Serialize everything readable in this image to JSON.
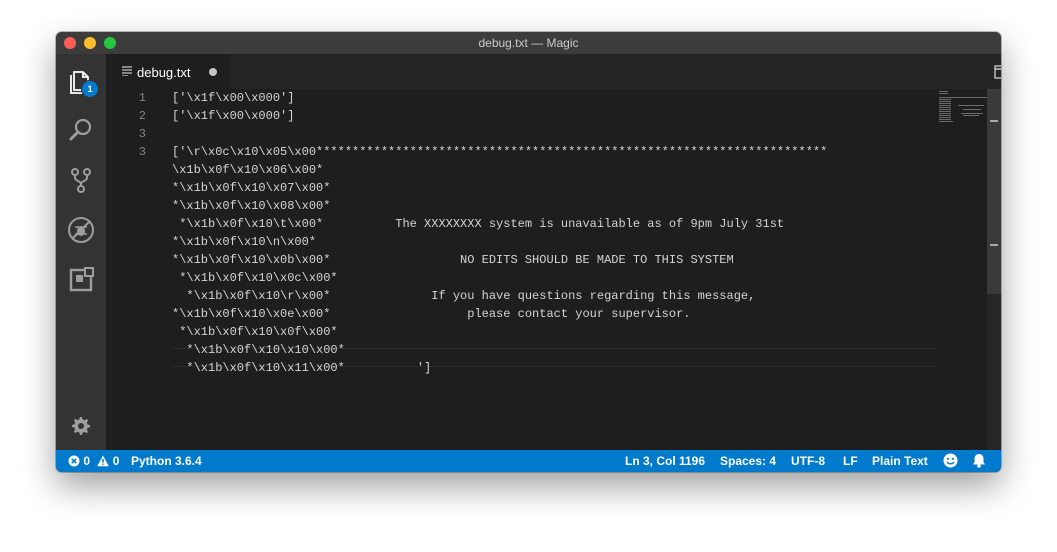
{
  "window": {
    "title": "debug.txt — Magic"
  },
  "activity_bar": {
    "items": [
      {
        "icon": "files-icon",
        "badge": "1"
      },
      {
        "icon": "search-icon"
      },
      {
        "icon": "source-control-icon"
      },
      {
        "icon": "debug-icon"
      },
      {
        "icon": "extensions-icon"
      }
    ],
    "settings_icon": "gear-icon"
  },
  "tab": {
    "label": "debug.txt"
  },
  "editor": {
    "lines": [
      {
        "num": "1",
        "text": "['\\x1f\\x00\\x000']"
      },
      {
        "num": "2",
        "text": "['\\x1f\\x00\\x000']"
      },
      {
        "num": "3",
        "text": ""
      },
      {
        "num": "3",
        "text": "['\\r\\x0c\\x10\\x05\\x00***********************************************************************"
      },
      {
        "num": "",
        "text": "\\x1b\\x0f\\x10\\x06\\x00*"
      },
      {
        "num": "",
        "text": "*\\x1b\\x0f\\x10\\x07\\x00*"
      },
      {
        "num": "",
        "text": "*\\x1b\\x0f\\x10\\x08\\x00*"
      },
      {
        "num": "",
        "text": " *\\x1b\\x0f\\x10\\t\\x00*          The XXXXXXXX system is unavailable as of 9pm July 31st"
      },
      {
        "num": "",
        "text": "*\\x1b\\x0f\\x10\\n\\x00*"
      },
      {
        "num": "",
        "text": "*\\x1b\\x0f\\x10\\x0b\\x00*                  NO EDITS SHOULD BE MADE TO THIS SYSTEM"
      },
      {
        "num": "",
        "text": " *\\x1b\\x0f\\x10\\x0c\\x00*"
      },
      {
        "num": "",
        "text": "  *\\x1b\\x0f\\x10\\r\\x00*              If you have questions regarding this message,"
      },
      {
        "num": "",
        "text": "*\\x1b\\x0f\\x10\\x0e\\x00*                   please contact your supervisor."
      },
      {
        "num": "",
        "text": " *\\x1b\\x0f\\x10\\x0f\\x00*"
      },
      {
        "num": "",
        "text": "  *\\x1b\\x0f\\x10\\x10\\x00*"
      },
      {
        "num": "",
        "text": "  *\\x1b\\x0f\\x10\\x11\\x00*          ']"
      }
    ]
  },
  "status_bar": {
    "errors": "0",
    "warnings": "0",
    "interpreter": "Python 3.6.4",
    "position": "Ln 3, Col 1196",
    "spaces": "Spaces: 4",
    "encoding": "UTF-8",
    "eol": "LF",
    "language": "Plain Text"
  },
  "colors": {
    "accent": "#007acc",
    "activity_bar": "#333333",
    "editor_bg": "#1e1e1e",
    "titlebar": "#3c3c3c"
  }
}
